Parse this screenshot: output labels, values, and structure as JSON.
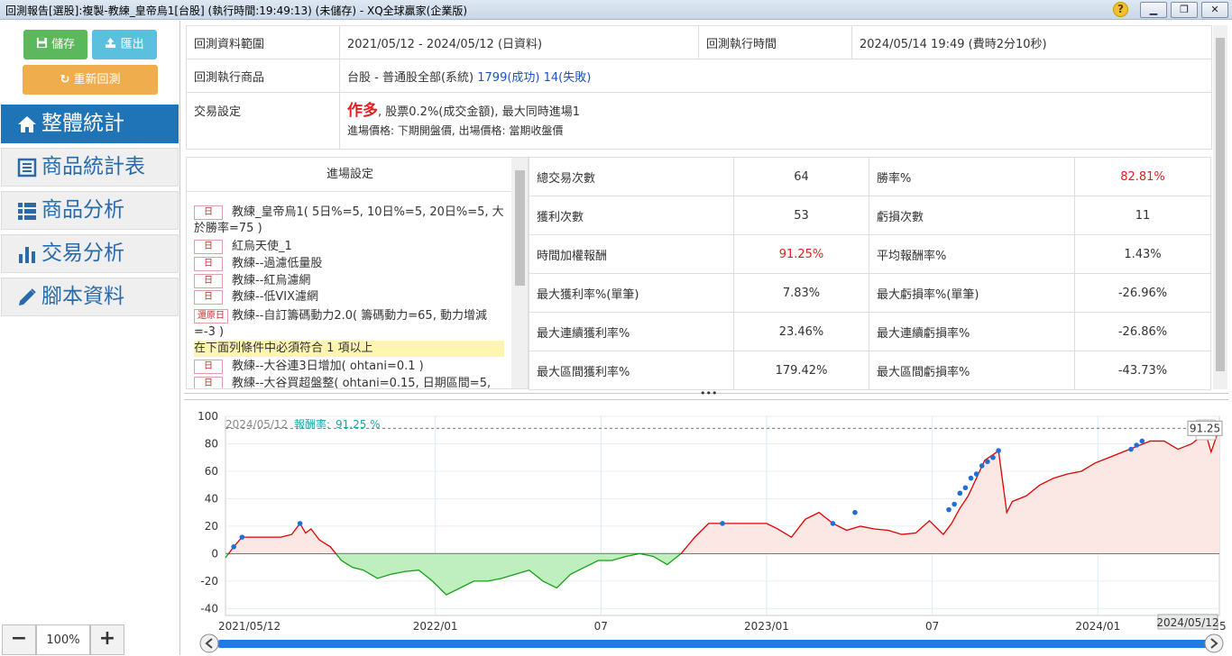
{
  "window": {
    "title": "回測報告[選股]:複製-教練_皇帝烏1[台股] (執行時間:19:49:13) (未儲存) - XQ全球贏家(企業版)",
    "help": "?",
    "minimize": "▁",
    "restore": "❐",
    "close": "✕"
  },
  "toolbar": {
    "save": "儲存",
    "export": "匯出",
    "rerun": "重新回測"
  },
  "nav": [
    {
      "label": "整體統計",
      "icon": "home-icon",
      "active": true
    },
    {
      "label": "商品統計表",
      "icon": "table-icon",
      "active": false
    },
    {
      "label": "商品分析",
      "icon": "list-icon",
      "active": false
    },
    {
      "label": "交易分析",
      "icon": "bar-chart-icon",
      "active": false
    },
    {
      "label": "腳本資料",
      "icon": "pencil-icon",
      "active": false
    }
  ],
  "zoom": {
    "minus": "−",
    "value": "100%",
    "plus": "+"
  },
  "info": {
    "range_label": "回測資料範圍",
    "range_value": "2021/05/12 - 2024/05/12 (日資料)",
    "time_label": "回測執行時間",
    "time_value": "2024/05/14 19:49 (費時2分10秒)",
    "product_label": "回測執行商品",
    "product_value": "台股 - 普通股全部(系統)",
    "product_success": "1799(成功)",
    "product_fail": "14(失敗)",
    "trade_label": "交易設定",
    "trade_direction": "作多",
    "trade_line1": ", 股票0.2%(成交金額), 最大同時進場1",
    "trade_line2": "進場價格: 下期開盤價, 出場價格: 當期收盤價"
  },
  "entry": {
    "header": "進場設定",
    "conditions": [
      {
        "tag": "日",
        "text": "教練_皇帝烏1( 5日%=5, 10日%=5, 20日%=5, 大於勝率=75 )"
      },
      {
        "tag": "日",
        "text": "紅烏天使_1"
      },
      {
        "tag": "日",
        "text": "教練--過濾低量股"
      },
      {
        "tag": "日",
        "text": "教練--紅烏濾網"
      },
      {
        "tag": "日",
        "text": "教練--低VIX濾網"
      },
      {
        "tag": "還原日",
        "text": "教練--自訂籌碼動力2.0( 籌碼動力=65, 動力增減=-3 )"
      }
    ],
    "highlight": "在下面列條件中必須符合 1 項以上",
    "conditions2": [
      {
        "tag": "日",
        "text": "教練--大谷連3日增加( ohtani=0.1 )"
      },
      {
        "tag": "日",
        "text": "教練--大谷買超盤整( ohtani=0.15, 日期區間=5,"
      }
    ]
  },
  "stats": [
    {
      "l1": "總交易次數",
      "v1": "64",
      "l2": "勝率%",
      "v2": "82.81%",
      "r1": false,
      "r2": true
    },
    {
      "l1": "獲利次數",
      "v1": "53",
      "l2": "虧損次數",
      "v2": "11",
      "r1": false,
      "r2": false
    },
    {
      "l1": "時間加權報酬",
      "v1": "91.25%",
      "l2": "平均報酬率%",
      "v2": "1.43%",
      "r1": true,
      "r2": false
    },
    {
      "l1": "最大獲利率%(單筆)",
      "v1": "7.83%",
      "l2": "最大虧損率%(單筆)",
      "v2": "-26.96%",
      "r1": false,
      "r2": false
    },
    {
      "l1": "最大連續獲利率%",
      "v1": "23.46%",
      "l2": "最大連續虧損率%",
      "v2": "-26.86%",
      "r1": false,
      "r2": false
    },
    {
      "l1": "最大區間獲利率%",
      "v1": "179.42%",
      "l2": "最大區間虧損率%",
      "v2": "-43.73%",
      "r1": false,
      "r2": false
    }
  ],
  "splitter": "•••",
  "chart_data": {
    "type": "area",
    "legend_date": "2024/05/12",
    "legend_label": "報酬率:",
    "legend_value": "91.25 %",
    "last_value_label": "91.25",
    "last_value": 91.25,
    "cursor_date_label": "2024/05/12",
    "ylim": [
      -45,
      100
    ],
    "yticks": [
      100,
      80,
      60,
      40,
      20,
      0,
      -20,
      -40
    ],
    "xticks": [
      "2021/05/12",
      "2022/01",
      "07",
      "2023/01",
      "07",
      "2024/01",
      "25"
    ],
    "xtick_months": [
      0,
      7.6,
      13.6,
      19.6,
      25.6,
      31.6,
      36
    ],
    "months_total": 36,
    "colors": {
      "positive": "#e00000",
      "negative": "#18a018",
      "pos_fill": "#fbe8e4",
      "neg_fill": "#bfeebf",
      "marker": "#1f6fd6"
    },
    "series": [
      {
        "x": [
          0,
          0.3,
          0.6,
          1.0,
          1.5,
          2.0,
          2.4,
          2.7,
          2.9,
          3.1,
          3.4,
          3.8,
          4.2,
          4.6,
          5.0,
          5.5,
          6.0,
          6.5,
          7.0,
          7.5,
          8.0,
          8.5,
          9.0,
          9.5,
          10.0,
          10.5,
          11.0,
          11.5,
          12.0,
          12.5,
          13.0,
          13.5,
          14.0,
          14.5,
          15.0,
          15.5,
          16.0,
          16.5,
          17.0,
          17.5,
          18.0,
          18.5,
          19.0,
          19.6,
          20.0,
          20.5,
          21.0,
          21.5,
          22.0,
          22.5,
          23.0,
          23.5,
          24.0,
          24.5,
          25.0,
          25.5,
          26.0,
          26.3,
          26.6,
          26.9,
          27.2,
          27.5,
          27.8,
          28.0,
          28.3,
          28.5,
          29.0,
          29.5,
          30.0,
          30.5,
          31.0,
          31.5,
          32.0,
          32.5,
          33.0,
          33.5,
          34.0,
          34.5,
          35.0,
          35.5,
          35.7,
          36.0
        ],
        "values": [
          -3,
          5,
          12,
          12,
          12,
          12,
          14,
          22,
          15,
          18,
          10,
          5,
          -5,
          -10,
          -12,
          -18,
          -15,
          -13,
          -12,
          -20,
          -30,
          -25,
          -20,
          -20,
          -18,
          -15,
          -12,
          -20,
          -25,
          -15,
          -10,
          -5,
          -5,
          -2,
          0,
          -2,
          -8,
          0,
          12,
          22,
          22,
          22,
          22,
          22,
          18,
          12,
          25,
          30,
          22,
          17,
          20,
          18,
          17,
          14,
          15,
          24,
          14,
          22,
          33,
          42,
          55,
          68,
          72,
          75,
          30,
          38,
          42,
          50,
          55,
          58,
          60,
          66,
          70,
          74,
          78,
          82,
          82,
          76,
          80,
          88,
          74,
          91.25
        ]
      }
    ],
    "markers": [
      {
        "x": 0.3,
        "y": 5
      },
      {
        "x": 0.6,
        "y": 12
      },
      {
        "x": 2.7,
        "y": 22
      },
      {
        "x": 18.0,
        "y": 22
      },
      {
        "x": 22.0,
        "y": 22
      },
      {
        "x": 22.8,
        "y": 30
      },
      {
        "x": 26.2,
        "y": 32
      },
      {
        "x": 26.4,
        "y": 36
      },
      {
        "x": 26.6,
        "y": 44
      },
      {
        "x": 26.8,
        "y": 48
      },
      {
        "x": 27.0,
        "y": 55
      },
      {
        "x": 27.2,
        "y": 58
      },
      {
        "x": 27.4,
        "y": 64
      },
      {
        "x": 27.6,
        "y": 67
      },
      {
        "x": 27.8,
        "y": 70
      },
      {
        "x": 28.0,
        "y": 75
      },
      {
        "x": 32.8,
        "y": 76
      },
      {
        "x": 33.0,
        "y": 79
      },
      {
        "x": 33.2,
        "y": 82
      },
      {
        "x": 35.4,
        "y": 88
      },
      {
        "x": 35.8,
        "y": 91.25
      }
    ]
  }
}
